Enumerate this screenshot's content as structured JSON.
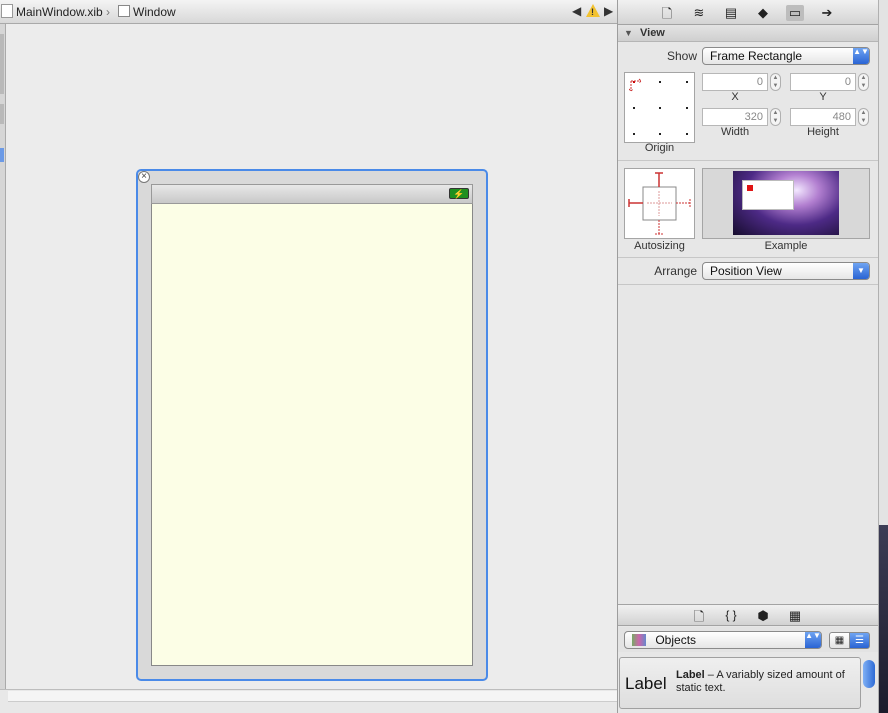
{
  "jumpbar": {
    "file": "MainWindow.xib",
    "separator": "›",
    "item": "Window",
    "prev": "◀",
    "next": "▶",
    "warning_glyph": "!"
  },
  "device": {
    "close_glyph": "×",
    "battery_glyph": "⚡"
  },
  "inspector": {
    "toolbar_icons": [
      "file-icon",
      "quick-help-icon",
      "identity-icon",
      "attributes-icon",
      "size-icon",
      "connections-icon"
    ],
    "section_title": "View",
    "show_label": "Show",
    "show_value": "Frame Rectangle",
    "popup_arrows": "▲▼",
    "x_value": "0",
    "y_value": "0",
    "width_value": "320",
    "height_value": "480",
    "x_label": "X",
    "y_label": "Y",
    "width_label": "Width",
    "height_label": "Height",
    "origin_label": "Origin",
    "autosizing_label": "Autosizing",
    "example_label": "Example",
    "arrange_label": "Arrange",
    "arrange_value": "Position View",
    "arrange_arrow": "▼"
  },
  "library": {
    "toolbar_icons": [
      "file-template-icon",
      "code-snippet-icon",
      "object-icon",
      "media-icon"
    ],
    "scope_value": "Objects",
    "item_title": "Label",
    "item_name": "Label",
    "item_desc": " – A variably sized amount of static text."
  }
}
